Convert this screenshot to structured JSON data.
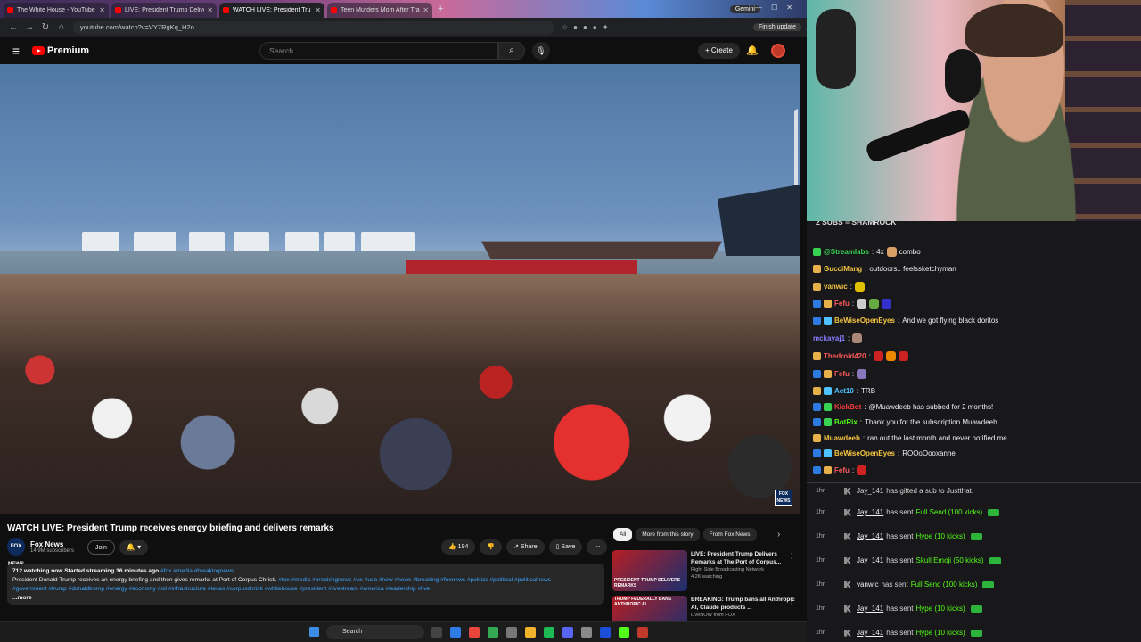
{
  "browser": {
    "tabs": [
      {
        "label": "The White House - YouTube",
        "active": false
      },
      {
        "label": "LIVE: President Trump Delivers",
        "active": false
      },
      {
        "label": "WATCH LIVE: President Tru",
        "active": true
      },
      {
        "label": "Teen Murders Mom After Tran",
        "active": false
      }
    ],
    "gemini_label": "Gemini",
    "url": "youtube.com/watch?v=VY7RgKq_H2o",
    "finish_update_label": "Finish update"
  },
  "youtube": {
    "logo_text": "Premium",
    "search_placeholder": "Search",
    "create_label": "Create",
    "video_title": "WATCH LIVE: President Trump receives energy briefing and delivers remarks",
    "channel": {
      "name": "Fox News",
      "logo_text": "FOX NEWS",
      "subscribers": "14.9M subscribers"
    },
    "join_label": "Join",
    "actions": {
      "likes": "194",
      "share": "Share",
      "save": "Save"
    },
    "description": {
      "stats": "712 watching now  Started streaming 36 minutes ago",
      "stats_tags": "#fox #media #breakingnews",
      "body": "President Donald Trump receives an energy briefing and then gives remarks at Port of Corpus Christi.",
      "body_tags": "#fox #media #breakingnews #us #usa #new #news #breaking #foxnews #politics #political #politicalnews",
      "tags_line": "#government #trump #donaldtrump #energy #economy #oil #infrastructure #texas #corpuschristi #whitehouse #president #livestream #america #leadership #live",
      "more": "...more"
    },
    "filter_chips": [
      "All",
      "More from this story",
      "From Fox News"
    ],
    "recommendations": [
      {
        "thumb_text": "PRESIDENT TRUMP DELIVERS REMARKS",
        "title": "LIVE: President Trump Delivers Remarks at The Port of Corpus...",
        "channel": "Right Side Broadcasting Network",
        "meta": "4.2K watching"
      },
      {
        "thumb_text": "TRUMP FEDERALLY BANS ANTHROPIC AI",
        "title": "BREAKING: Trump bans all Anthropic AI, Claude products ...",
        "channel": "LiveNOW from FOX",
        "meta": ""
      }
    ]
  },
  "taskbar": {
    "search_label": "Search"
  },
  "chat": {
    "subs_banner": "2 SUBS = SHAMROCK",
    "messages": [
      {
        "user": "@Streamlabs",
        "color": "#39d353",
        "text": "4x",
        "after": "combo"
      },
      {
        "user": "GucciMang",
        "color": "#f5c542",
        "text": "outdoors.. feelssketchyman"
      },
      {
        "user": "vanwic",
        "color": "#f5c542",
        "text": ""
      },
      {
        "user": "Fefu",
        "color": "#ff5a5a",
        "text": ""
      },
      {
        "user": "BeWiseOpenEyes",
        "color": "#f5c542",
        "text": "And we got flying black doritos"
      },
      {
        "user": "mckayaj1",
        "color": "#8a7dff",
        "text": ""
      },
      {
        "user": "Thedroid420",
        "color": "#ff5a5a",
        "text": ""
      },
      {
        "user": "Fefu",
        "color": "#ff5a5a",
        "text": ""
      },
      {
        "user": "Act10",
        "color": "#4fc3ff",
        "text": "TRB"
      },
      {
        "user": "KickBot",
        "color": "#ff3b3b",
        "text": "@Muawdeeb has subbed for 2 months!"
      },
      {
        "user": "BotRix",
        "color": "#53fc18",
        "text": "Thank you for the subscription Muawdeeb"
      },
      {
        "user": "Muawdeeb",
        "color": "#f5c542",
        "text": "ran out the last month and never notified me"
      },
      {
        "user": "BeWiseOpenEyes",
        "color": "#f5c542",
        "text": "ROOoOooxanne"
      },
      {
        "user": "Fefu",
        "color": "#ff5a5a",
        "text": ""
      }
    ],
    "events": [
      {
        "time": "1hr",
        "name": "Jay_141",
        "text": "has gifted a sub to Justthat.",
        "item": "",
        "money": false
      },
      {
        "time": "1hr",
        "name": "Jay_141",
        "text": "has sent",
        "item": "Full Send (100 kicks)",
        "money": true
      },
      {
        "time": "1hr",
        "name": "Jay_141",
        "text": "has sent",
        "item": "Hype (10 kicks)",
        "money": true
      },
      {
        "time": "1hr",
        "name": "Jay_141",
        "text": "has sent",
        "item": "Skull Emoji (50 kicks)",
        "money": true
      },
      {
        "time": "1hr",
        "name": "vanwic",
        "text": "has sent",
        "item": "Full Send (100 kicks)",
        "money": true
      },
      {
        "time": "1hr",
        "name": "Jay_141",
        "text": "has sent",
        "item": "Hype (10 kicks)",
        "money": true
      },
      {
        "time": "1hr",
        "name": "Jay_141",
        "text": "has sent",
        "item": "Hype (10 kicks)",
        "money": true
      }
    ]
  }
}
